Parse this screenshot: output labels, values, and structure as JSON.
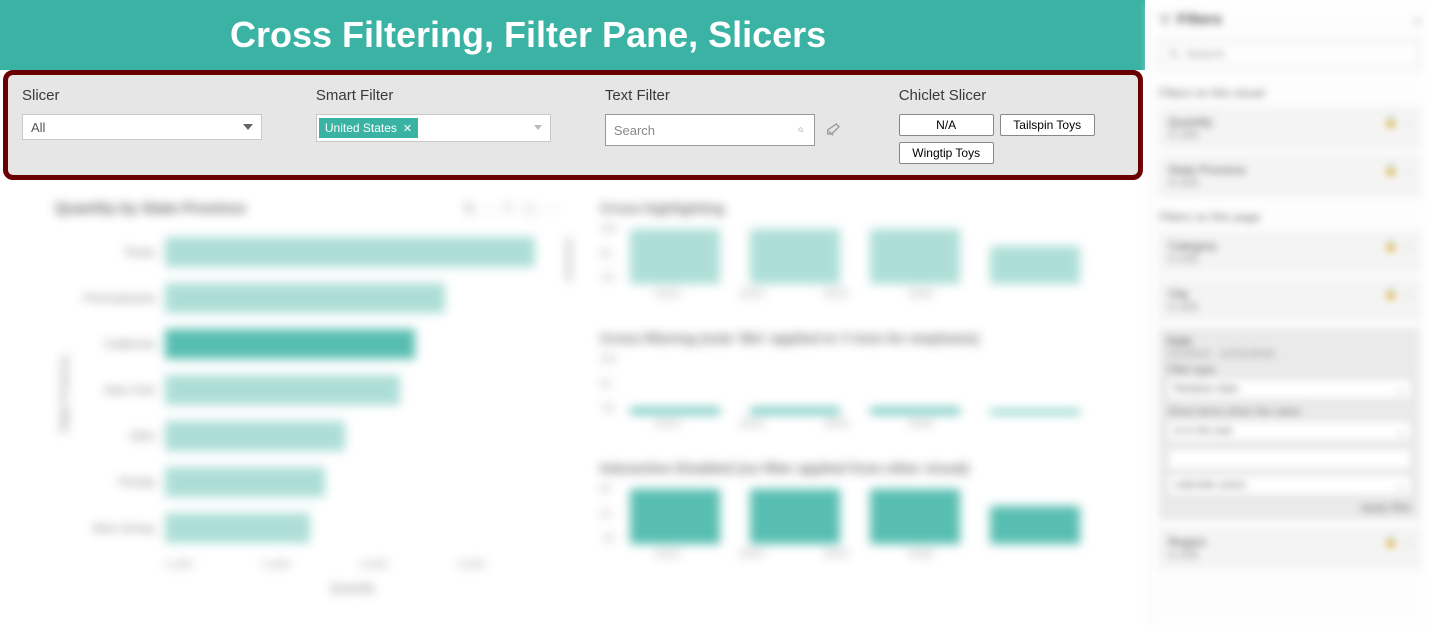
{
  "banner": {
    "title": "Cross Filtering, Filter Pane, Slicers"
  },
  "slicers": {
    "dropdown": {
      "label": "Slicer",
      "value": "All"
    },
    "smart": {
      "label": "Smart Filter",
      "tag": "United States"
    },
    "text": {
      "label": "Text Filter",
      "placeholder": "Search"
    },
    "chiclet": {
      "label": "Chiclet Slicer",
      "options": [
        "N/A",
        "Tailspin Toys",
        "Wingtip Toys"
      ]
    }
  },
  "left_chart_title": "Quantity by State Province",
  "toolbar_icons": [
    "drill-icon",
    "drill-down-icon",
    "filter-icon",
    "focus-icon",
    "more-icon"
  ],
  "y_axis_title": "State Province",
  "x_axis_title": "Quantity",
  "mini_titles": {
    "a": "Cross-highlighting",
    "b": "Cross-filtering (note 'Bin' applied to Y-Axis for emphasis)",
    "c": "Interaction Disabled (no filter applied from other visual)"
  },
  "filters_pane": {
    "title": "Filters",
    "search_placeholder": "Search",
    "section_visual": "Filters on this visual",
    "section_page": "Filters on this page",
    "fields": {
      "quantity": "Quantity",
      "state": "State Province",
      "category": "Category",
      "city": "City",
      "date": "Date",
      "region": "Region"
    },
    "is_all": "is (All)",
    "date_range": "1/1/2013 - 12/31/2016",
    "filter_type_label": "Filter type",
    "filter_type_value": "Relative date",
    "show_items_label": "Show items when the value",
    "show_items_value": "is in the last",
    "units_value": "calendar years",
    "apply": "Apply filter"
  },
  "chart_data": [
    {
      "type": "bar",
      "title": "Quantity by State Province",
      "orientation": "horizontal",
      "xlabel": "Quantity",
      "ylabel": "State Province",
      "xlim": [
        0,
        5000
      ],
      "categories": [
        "Texas",
        "Pennsylvania",
        "California",
        "New York",
        "Ohio",
        "Florida",
        "New Jersey"
      ],
      "values": [
        4900,
        3700,
        3300,
        3100,
        2400,
        2100,
        1900
      ],
      "highlighted_category": "California"
    },
    {
      "type": "bar",
      "title": "Cross-highlighting",
      "categories": [
        "2013",
        "2014",
        "2015",
        "2016"
      ],
      "values": [
        150,
        150,
        150,
        100
      ],
      "ylim": [
        0,
        150
      ],
      "color": "light"
    },
    {
      "type": "bar",
      "title": "Cross-filtering (note 'Bin' applied to Y-Axis for emphasis)",
      "categories": [
        "2013",
        "2014",
        "2015",
        "2016"
      ],
      "values": [
        8,
        8,
        8,
        5
      ],
      "ylim": [
        0,
        150
      ],
      "color": "dark"
    },
    {
      "type": "bar",
      "title": "Interaction Disabled (no filter applied from other visual)",
      "categories": [
        "2013",
        "2014",
        "2015",
        "2016"
      ],
      "values": [
        60,
        60,
        60,
        40
      ],
      "ylim": [
        0,
        60
      ],
      "color": "dark"
    }
  ]
}
